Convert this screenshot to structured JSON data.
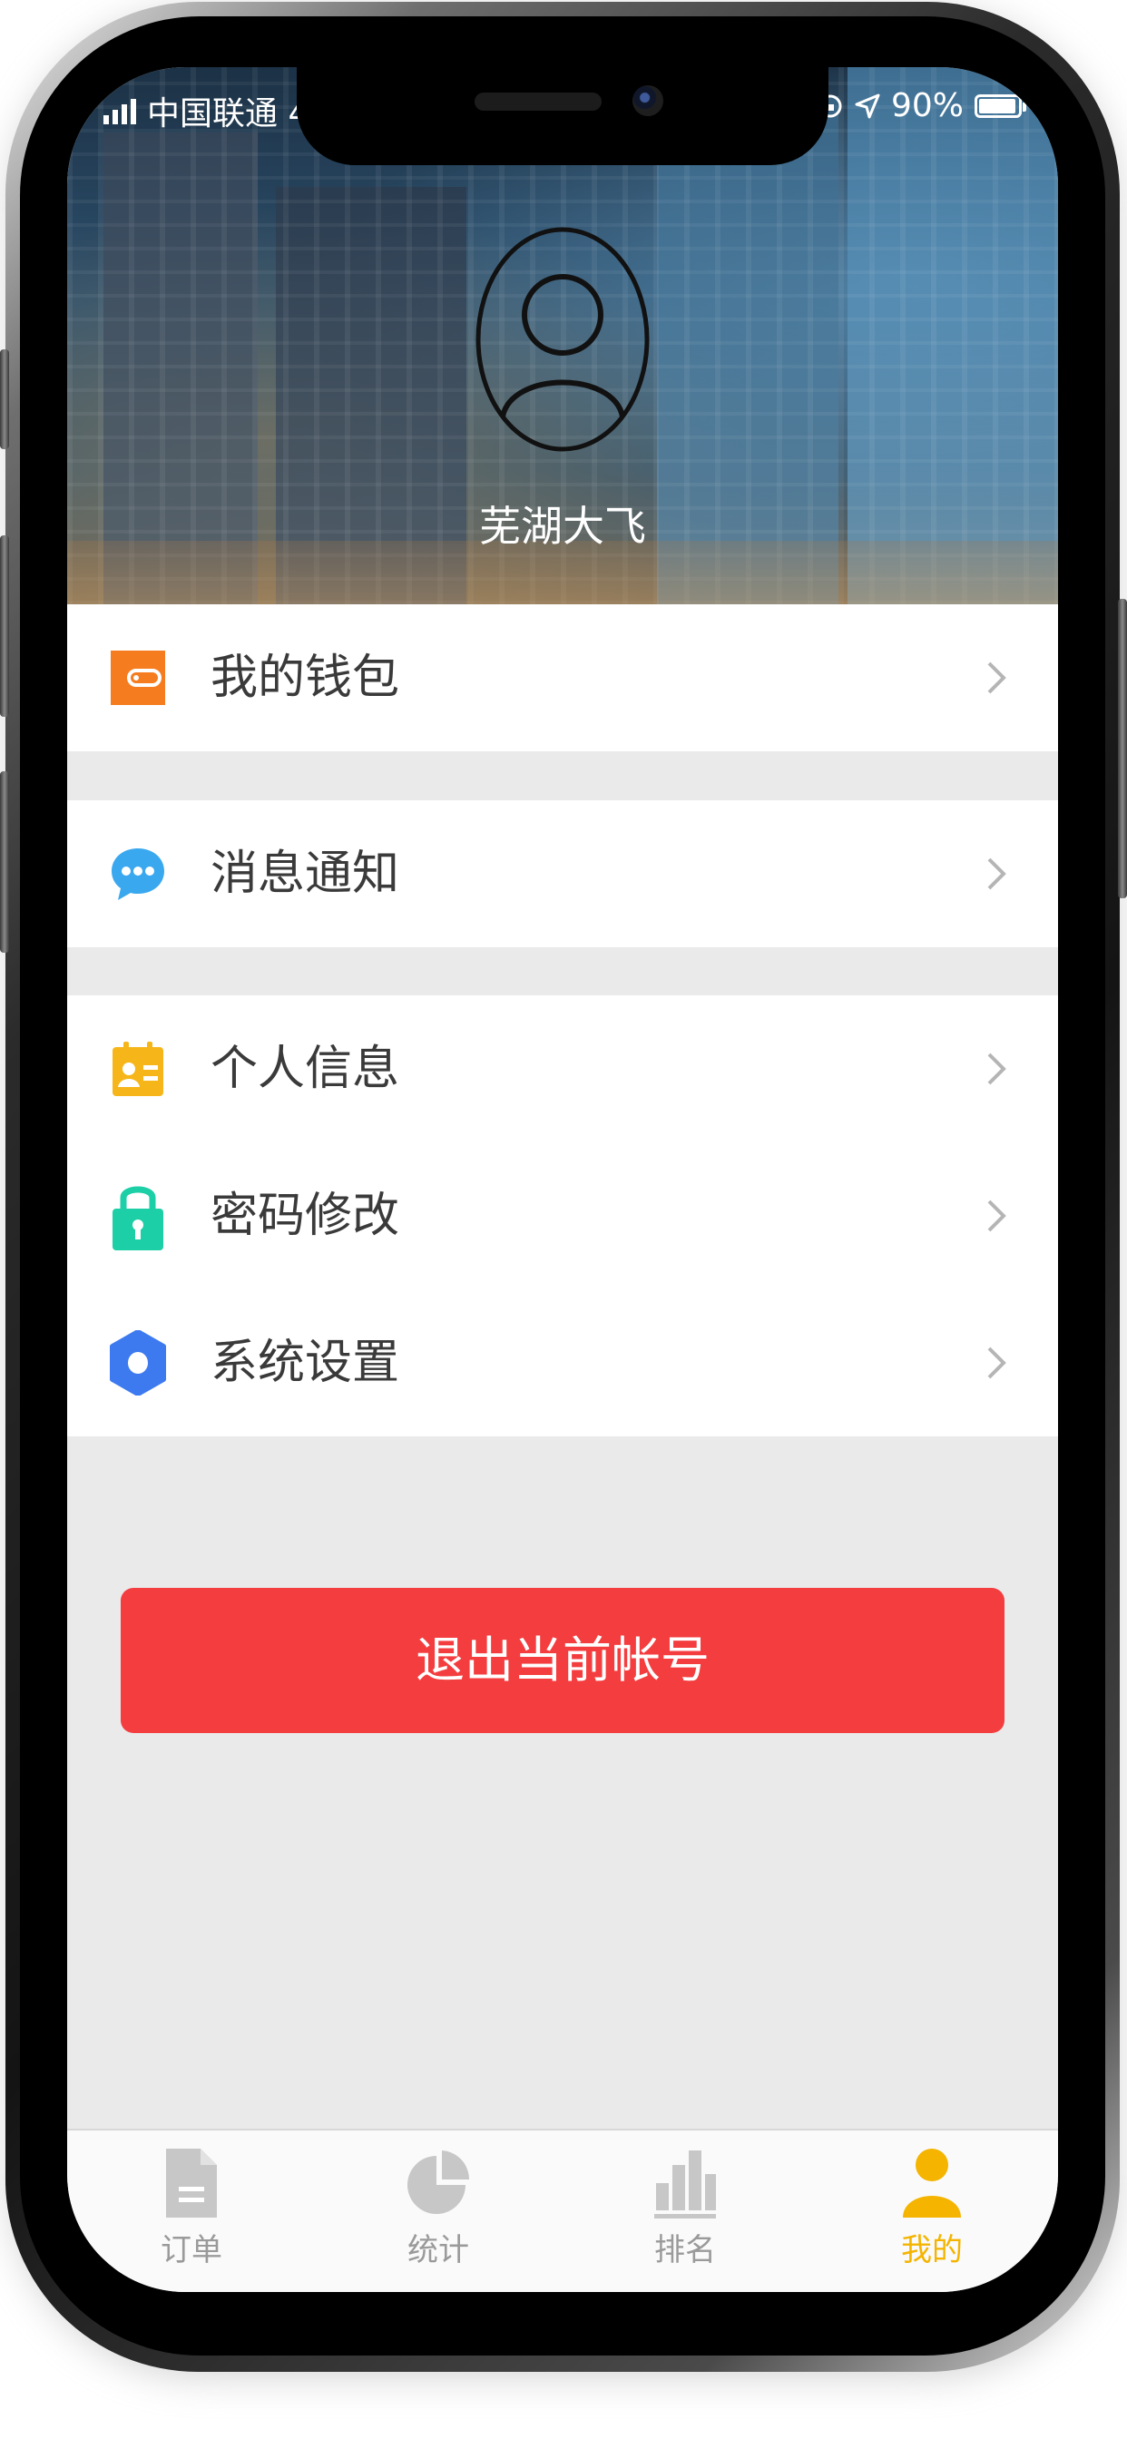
{
  "status_bar": {
    "carrier": "中国联通 4",
    "battery": "90%"
  },
  "profile": {
    "username": "芜湖大飞"
  },
  "menu": {
    "groups": [
      [
        {
          "label": "我的钱包",
          "icon": "wallet-icon",
          "color": "#f57c1f"
        }
      ],
      [
        {
          "label": "消息通知",
          "icon": "chat-bubble-icon",
          "color": "#3aa8ef"
        }
      ],
      [
        {
          "label": "个人信息",
          "icon": "id-card-icon",
          "color": "#f6b619"
        },
        {
          "label": "密码修改",
          "icon": "lock-icon",
          "color": "#1ccfa7"
        },
        {
          "label": "系统设置",
          "icon": "gear-icon",
          "color": "#3d7af0"
        }
      ]
    ]
  },
  "logout_button": {
    "label": "退出当前帐号",
    "color": "#f43d3f"
  },
  "tabbar": {
    "active_color": "#f4b400",
    "inactive_color": "#9a9a9a",
    "tabs": [
      {
        "label": "订单",
        "icon": "document-icon",
        "active": false
      },
      {
        "label": "统计",
        "icon": "pie-chart-icon",
        "active": false
      },
      {
        "label": "排名",
        "icon": "bar-chart-icon",
        "active": false
      },
      {
        "label": "我的",
        "icon": "user-icon",
        "active": true
      }
    ]
  }
}
